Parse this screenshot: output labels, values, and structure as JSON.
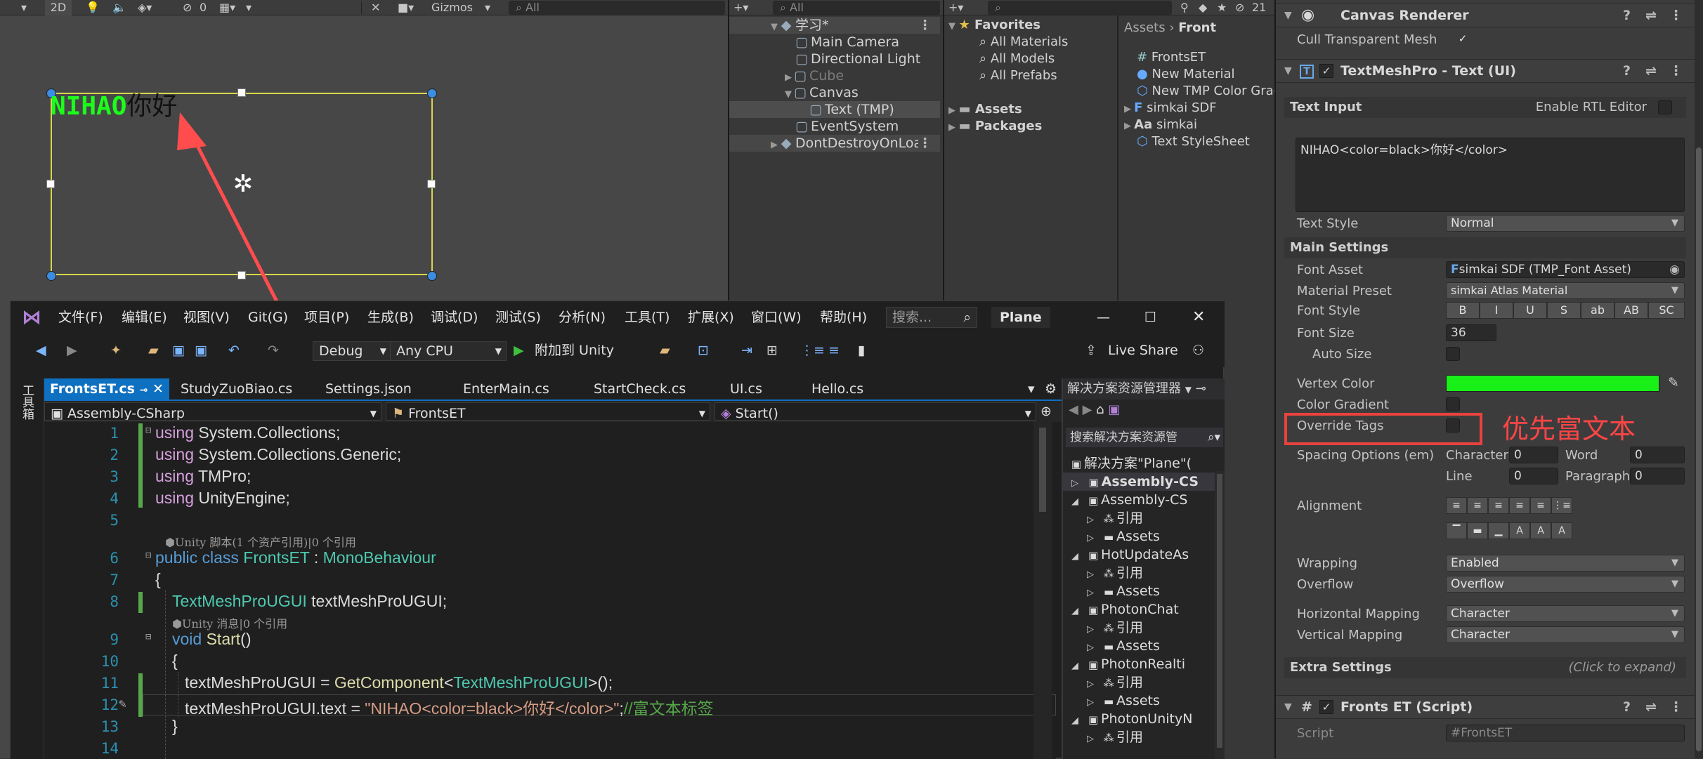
{
  "scene": {
    "toolbar": {
      "mode_2d": "2D",
      "hidden_count": "0",
      "gizmos": "Gizmos",
      "search_placeholder": "All"
    },
    "text_green": "NIHAO",
    "text_black": "你好"
  },
  "hierarchy": {
    "search_placeholder": "All",
    "items": [
      {
        "label": "学习*"
      },
      {
        "label": "Main Camera"
      },
      {
        "label": "Directional Light"
      },
      {
        "label": "Cube"
      },
      {
        "label": "Canvas"
      },
      {
        "label": "Text (TMP)"
      },
      {
        "label": "EventSystem"
      },
      {
        "label": "DontDestroyOnLoad"
      }
    ]
  },
  "project": {
    "hidden_count": "21",
    "favorites": {
      "label": "Favorites",
      "items": [
        "All Materials",
        "All Models",
        "All Prefabs"
      ]
    },
    "roots": [
      "Assets",
      "Packages"
    ],
    "breadcrumb": {
      "root": "Assets",
      "sep": "›",
      "current": "Front"
    },
    "files": [
      "FrontsET",
      "New Material",
      "New TMP Color Gradient",
      "simkai SDF",
      "simkai",
      "Text StyleSheet"
    ]
  },
  "inspector": {
    "canvas_renderer": {
      "title": "Canvas Renderer",
      "cull_label": "Cull Transparent Mesh"
    },
    "tmp": {
      "title": "TextMeshPro - Text (UI)",
      "text_input": "Text Input",
      "rtl": "Enable RTL Editor",
      "text_value": "NIHAO<color=black>你好</color>",
      "text_style_label": "Text Style",
      "text_style": "Normal",
      "main_settings": "Main Settings",
      "font_asset_label": "Font Asset",
      "font_asset": "simkai SDF (TMP_Font Asset)",
      "material_preset_label": "Material Preset",
      "material_preset": "simkai Atlas Material",
      "font_style_label": "Font Style",
      "font_style_buttons": [
        "B",
        "I",
        "U",
        "S",
        "ab",
        "AB",
        "SC"
      ],
      "font_size_label": "Font Size",
      "font_size": "36",
      "auto_size_label": "Auto Size",
      "vertex_color_label": "Vertex Color",
      "vertex_color": "#18f018",
      "color_gradient_label": "Color Gradient",
      "override_tags_label": "Override Tags",
      "spacing_label": "Spacing Options (em)",
      "spacing": {
        "character_label": "Character",
        "character": "0",
        "word_label": "Word",
        "word": "0",
        "line_label": "Line",
        "line": "0",
        "paragraph_label": "Paragraph",
        "paragraph": "0"
      },
      "alignment_label": "Alignment",
      "wrapping_label": "Wrapping",
      "wrapping": "Enabled",
      "overflow_label": "Overflow",
      "overflow": "Overflow",
      "h_mapping_label": "Horizontal Mapping",
      "h_mapping": "Character",
      "v_mapping_label": "Vertical Mapping",
      "v_mapping": "Character",
      "extra_settings": "Extra Settings",
      "click_expand": "(Click to expand)"
    },
    "script": {
      "title": "Fronts ET (Script)",
      "script_label": "Script",
      "script_value": "FrontsET"
    }
  },
  "annotation": {
    "text": "优先富文本",
    "color": "#ff4545"
  },
  "vs": {
    "menu": [
      "文件(F)",
      "编辑(E)",
      "视图(V)",
      "Git(G)",
      "项目(P)",
      "生成(B)",
      "调试(D)",
      "测试(S)",
      "分析(N)",
      "工具(T)",
      "扩展(X)",
      "窗口(W)",
      "帮助(H)"
    ],
    "search_placeholder": "搜索...",
    "project_name": "Plane",
    "config": "Debug",
    "platform": "Any CPU",
    "attach": "附加到 Unity",
    "live_share": "Live Share",
    "side_tab": "工具箱",
    "tabs": [
      "FrontsET.cs",
      "StudyZuoBiao.cs",
      "Settings.json",
      "EnterMain.cs",
      "StartCheck.cs",
      "UI.cs",
      "Hello.cs"
    ],
    "nav": {
      "project": "Assembly-CSharp",
      "class": "FrontsET",
      "method": "Start()"
    },
    "code": {
      "line1_kw": "using",
      "line1_ns": "System.Collections;",
      "line2_kw": "using",
      "line2_ns": "System.Collections.Generic;",
      "line3_kw": "using",
      "line3_ns": "TMPro;",
      "line4_kw": "using",
      "line4_ns": "UnityEngine;",
      "hint1": "⬢Unity 脚本(1 个资产引用)|0 个引用",
      "line6_kw1": "public",
      "line6_kw2": "class",
      "line6_name": "FrontsET",
      "line6_colon": ":",
      "line6_base": "MonoBehaviour",
      "brace_open": "{",
      "line8_type": "TextMeshProUGUI",
      "line8_var": "textMeshProUGUI;",
      "hint2": "⬢Unity 消息|0 个引用",
      "line9_kw": "void",
      "line9_fn": "Start",
      "line9_paren": "()",
      "line11_a": "textMeshProUGUI = ",
      "line11_fn": "GetComponent",
      "line11_lt": "<",
      "line11_type": "TextMeshProUGUI",
      "line11_end": ">();",
      "line12_a": "textMeshProUGUI.text = ",
      "line12_str": "\"NIHAO<color=black>你好</color>\"",
      "line12_semi": ";",
      "line12_cm": "//富文本标签",
      "brace_close": "}"
    },
    "line_numbers": [
      "1",
      "2",
      "3",
      "4",
      "5",
      "6",
      "7",
      "8",
      "9",
      "10",
      "11",
      "12",
      "13",
      "14"
    ],
    "solution": {
      "title": "解决方案资源管理器",
      "search": "搜索解决方案资源管",
      "items": [
        "解决方案\"Plane\"(",
        "Assembly-CS",
        "Assembly-CS",
        "引用",
        "Assets",
        "HotUpdateAs",
        "引用",
        "Assets",
        "PhotonChat",
        "引用",
        "Assets",
        "PhotonRealti",
        "引用",
        "Assets",
        "PhotonUnityN",
        "引用"
      ]
    }
  }
}
